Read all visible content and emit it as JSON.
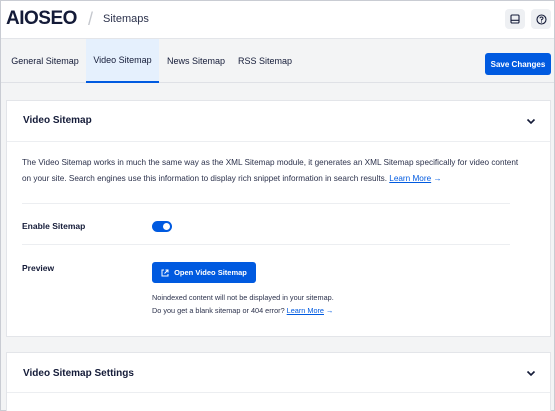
{
  "header": {
    "logo_text": "AIOSEO",
    "breadcrumb": "Sitemaps",
    "icons": [
      "notifications-icon",
      "help-icon"
    ]
  },
  "tabs": [
    {
      "label": "General Sitemap",
      "active": false
    },
    {
      "label": "Video Sitemap",
      "active": true
    },
    {
      "label": "News Sitemap",
      "active": false
    },
    {
      "label": "RSS Sitemap",
      "active": false
    }
  ],
  "actions": {
    "save_label": "Save Changes"
  },
  "video_card": {
    "title": "Video Sitemap",
    "description": "The Video Sitemap works in much the same way as the XML Sitemap module, it generates an XML Sitemap specifically for video content on your site. Search engines use this information to display rich snippet information in search results.",
    "learn_more": "Learn More",
    "learn_more_arrow": "→",
    "enable_label": "Enable Sitemap",
    "enable_value": true,
    "preview_label": "Preview",
    "open_button": "Open Video Sitemap",
    "note_line1": "Noindexed content will not be displayed in your sitemap.",
    "note_line2": "Do you get a blank sitemap or 404 error?",
    "note_link": "Learn More",
    "note_arrow": "→"
  },
  "settings_card": {
    "title": "Video Sitemap Settings"
  },
  "colors": {
    "accent": "#005ae0",
    "text": "#141b38",
    "background": "#f3f4f5"
  }
}
